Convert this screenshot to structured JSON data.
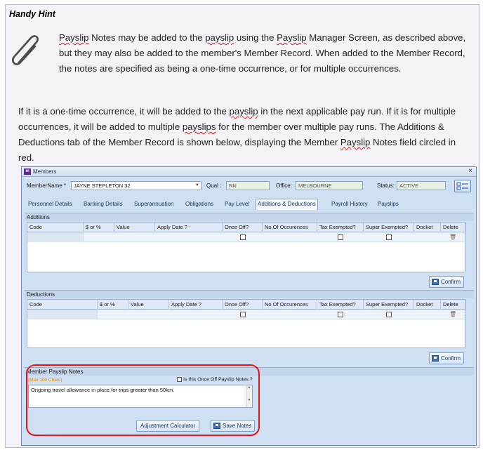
{
  "hint": {
    "title": "Handy Hint",
    "para1_parts": [
      "Payslip",
      " Notes may be added to the ",
      "payslip",
      " using the ",
      "Payslip",
      " Manager Screen, as described above, but they may also be added to the member's Member Record. When added to the Member Record, the notes are specified as being a one-time occurrence, or for multiple occurrences."
    ],
    "para2_parts": [
      "If it is a one-time occurrence, it will be added to the ",
      "payslip",
      " in the next applicable pay run. If it is for multiple occurrences, it will be added to multiple ",
      "payslips",
      " for the member over multiple pay runs. The Additions & Deductions tab of the Member Record is shown below, displaying the Member ",
      "Payslip",
      " Notes field circled in red."
    ]
  },
  "window": {
    "title": "Members",
    "app_icon": "m",
    "close": "×",
    "member_name_label": "MemberName *",
    "member_name_value": "JAYNE STEPLETON 32",
    "qual_label": "Qual :",
    "qual_value": "RN",
    "office_label": "Office:",
    "office_value": "MELBOURNE",
    "status_label": "Status:",
    "status_value": "ACTIVE"
  },
  "tabs": [
    "Personnel Details",
    "Banking Details",
    "Superannuation",
    "Obligations",
    "Pay Level",
    "Additions & Deductions",
    "Payroll History",
    "Payslips"
  ],
  "additions": {
    "title": "Additions",
    "columns": [
      "Code",
      "$ or %",
      "Value",
      "Apply Date ?",
      "Once Off?",
      "No.Of Occurences",
      "Tax Exempted?",
      "Super Exempted?",
      "Docket",
      "Delete"
    ],
    "confirm_label": "Confirm"
  },
  "deductions": {
    "title": "Deductions",
    "columns": [
      "Code",
      "$ or %",
      "Value",
      "Apply Date ?",
      "Once Off?",
      "No Of Occurences",
      "Tax Exempted?",
      "Super Exempted?",
      "Docket",
      "Delete"
    ],
    "confirm_label": "Confirm"
  },
  "notes": {
    "title": "Member Payslip Notes",
    "max_chars": "(Max 100 Chars)",
    "once_off_label": "Is this Once Off Payslip Notes ?",
    "text": "Ongoing travel allowance in place for trips greater than 50km.",
    "adjustment_label": "Adjustment Calculator",
    "save_label": "Save Notes"
  },
  "colors": {
    "highlight_ring": "#e0141a",
    "window_bg": "#cfe0f2"
  }
}
